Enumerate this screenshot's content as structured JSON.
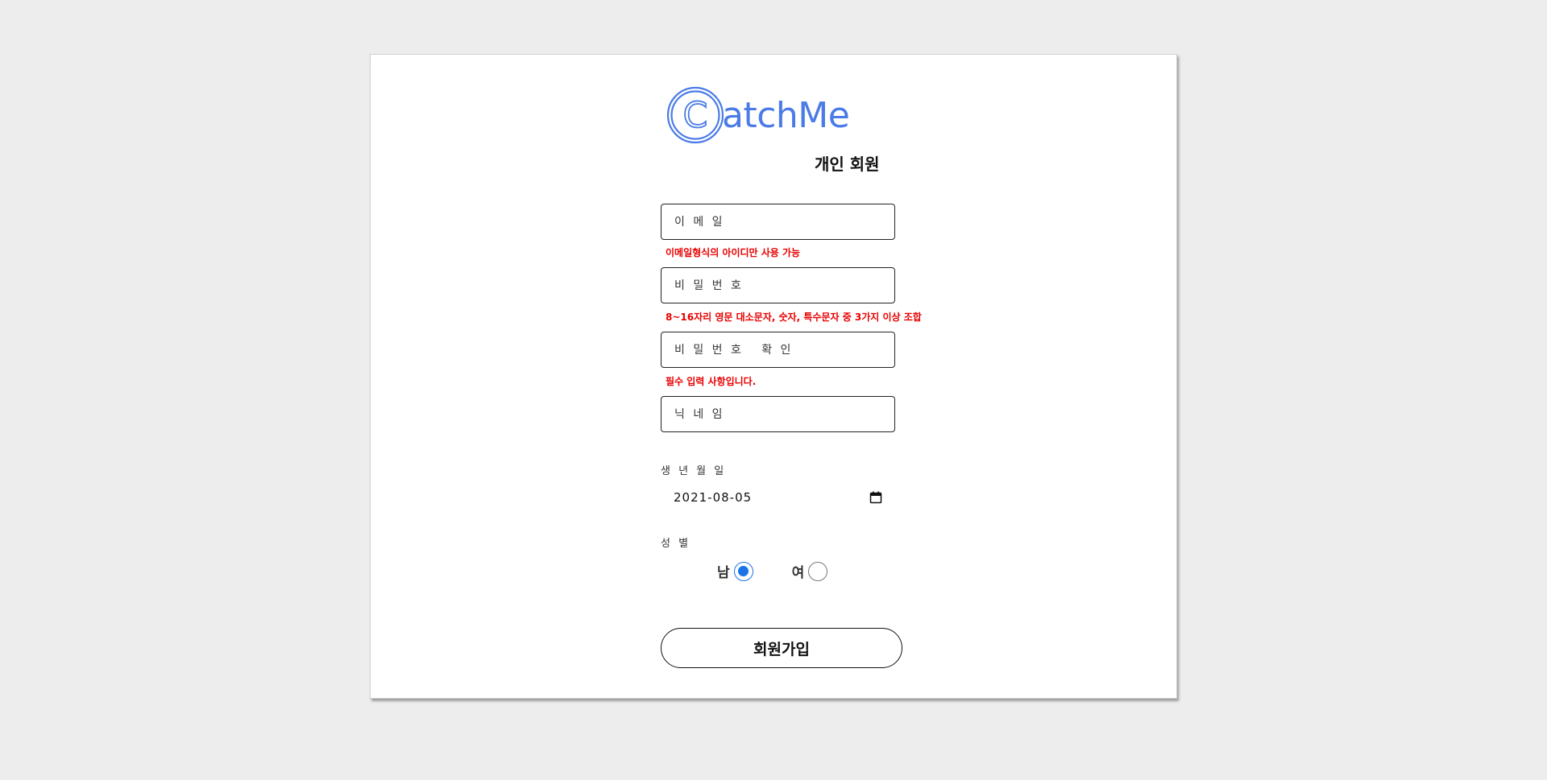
{
  "brand": {
    "name": "atchMe",
    "logo_letter": "C",
    "color": "#4a7be6"
  },
  "page_title": "개인 회원",
  "form": {
    "email": {
      "placeholder": "이 메 일",
      "value": ""
    },
    "email_error": "이메일형식의 아이디만 사용 가능",
    "password": {
      "placeholder": "비 밀 번 호",
      "value": ""
    },
    "password_error": "8~16자리 영문 대소문자, 숫자, 특수문자 중 3가지 이상 조합",
    "password_confirm": {
      "placeholder": "비 밀 번 호   확 인",
      "value": ""
    },
    "password_confirm_error": "필수 입력 사항입니다.",
    "nickname": {
      "placeholder": "닉 네 임",
      "value": ""
    },
    "birthdate": {
      "label": "생 년 월 일",
      "value": "2021-08-05"
    },
    "gender": {
      "label": "성 별",
      "options": [
        {
          "label": "남",
          "selected": true
        },
        {
          "label": "여",
          "selected": false
        }
      ]
    },
    "submit_label": "회원가입"
  },
  "colors": {
    "error": "#e80000",
    "radio_selected": "#1a73e8",
    "background": "#ededed"
  },
  "icons": {
    "logo": "catchme-logo-icon",
    "calendar": "calendar-icon"
  }
}
